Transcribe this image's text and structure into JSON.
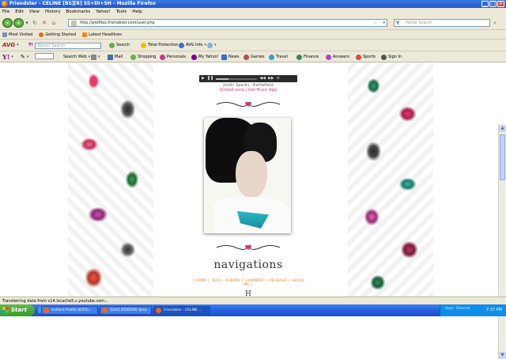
{
  "window": {
    "title": "Friendster - CELINE [BS][R] SS+DI+SH - Mozilla Firefox"
  },
  "menu": [
    "File",
    "Edit",
    "View",
    "History",
    "Bookmarks",
    "Yahoo!",
    "Tools",
    "Help"
  ],
  "nav": {
    "url": "http://profiles.friendster.com/user.php",
    "search_placeholder": "Yahoo Search"
  },
  "bookmarks": [
    "Most Visited",
    "Getting Started",
    "Latest Headlines"
  ],
  "avg_toolbar": {
    "logo": "AVG",
    "yahoo_input_placeholder": "Yahoo! Search",
    "search_label": "Search",
    "total_protection": "Total Protection",
    "avg_info": "AVG Info"
  },
  "yahoo_toolbar": {
    "logo": "Y!",
    "search_web": "Search Web",
    "items": [
      "Mail",
      "Shopping",
      "Personals",
      "My Yahoo!",
      "News",
      "Games",
      "Travel",
      "Finance",
      "Answers",
      "Sports",
      "Sign In"
    ]
  },
  "player": {
    "song": "Jordin Sparks - Battlefield",
    "links": "Embed song | Get Music App"
  },
  "page": {
    "nav_heading": "navigations",
    "nav_links": [
      "HOME",
      "ADD",
      "ALBUMS",
      "COMMENT",
      "MESSAGE",
      "BLOCK ME"
    ],
    "bottom_char": "H"
  },
  "status": {
    "text": "Transferring data from v14.lscache5.c.youtube.com..."
  },
  "taskbar": {
    "start": "Start",
    "tasks": [
      "Hottest Profile (KZIII)...",
      "[Edit] (EDISON) (Jess...",
      "Friendster - CELINE ..."
    ],
    "tray_text": "Норо · Ethernet",
    "clock": "7:37 PM"
  },
  "colors": {
    "accent_pink": "#d2357e",
    "nav_link_orange": "#e08a2a",
    "xp_blue": "#245edb"
  }
}
